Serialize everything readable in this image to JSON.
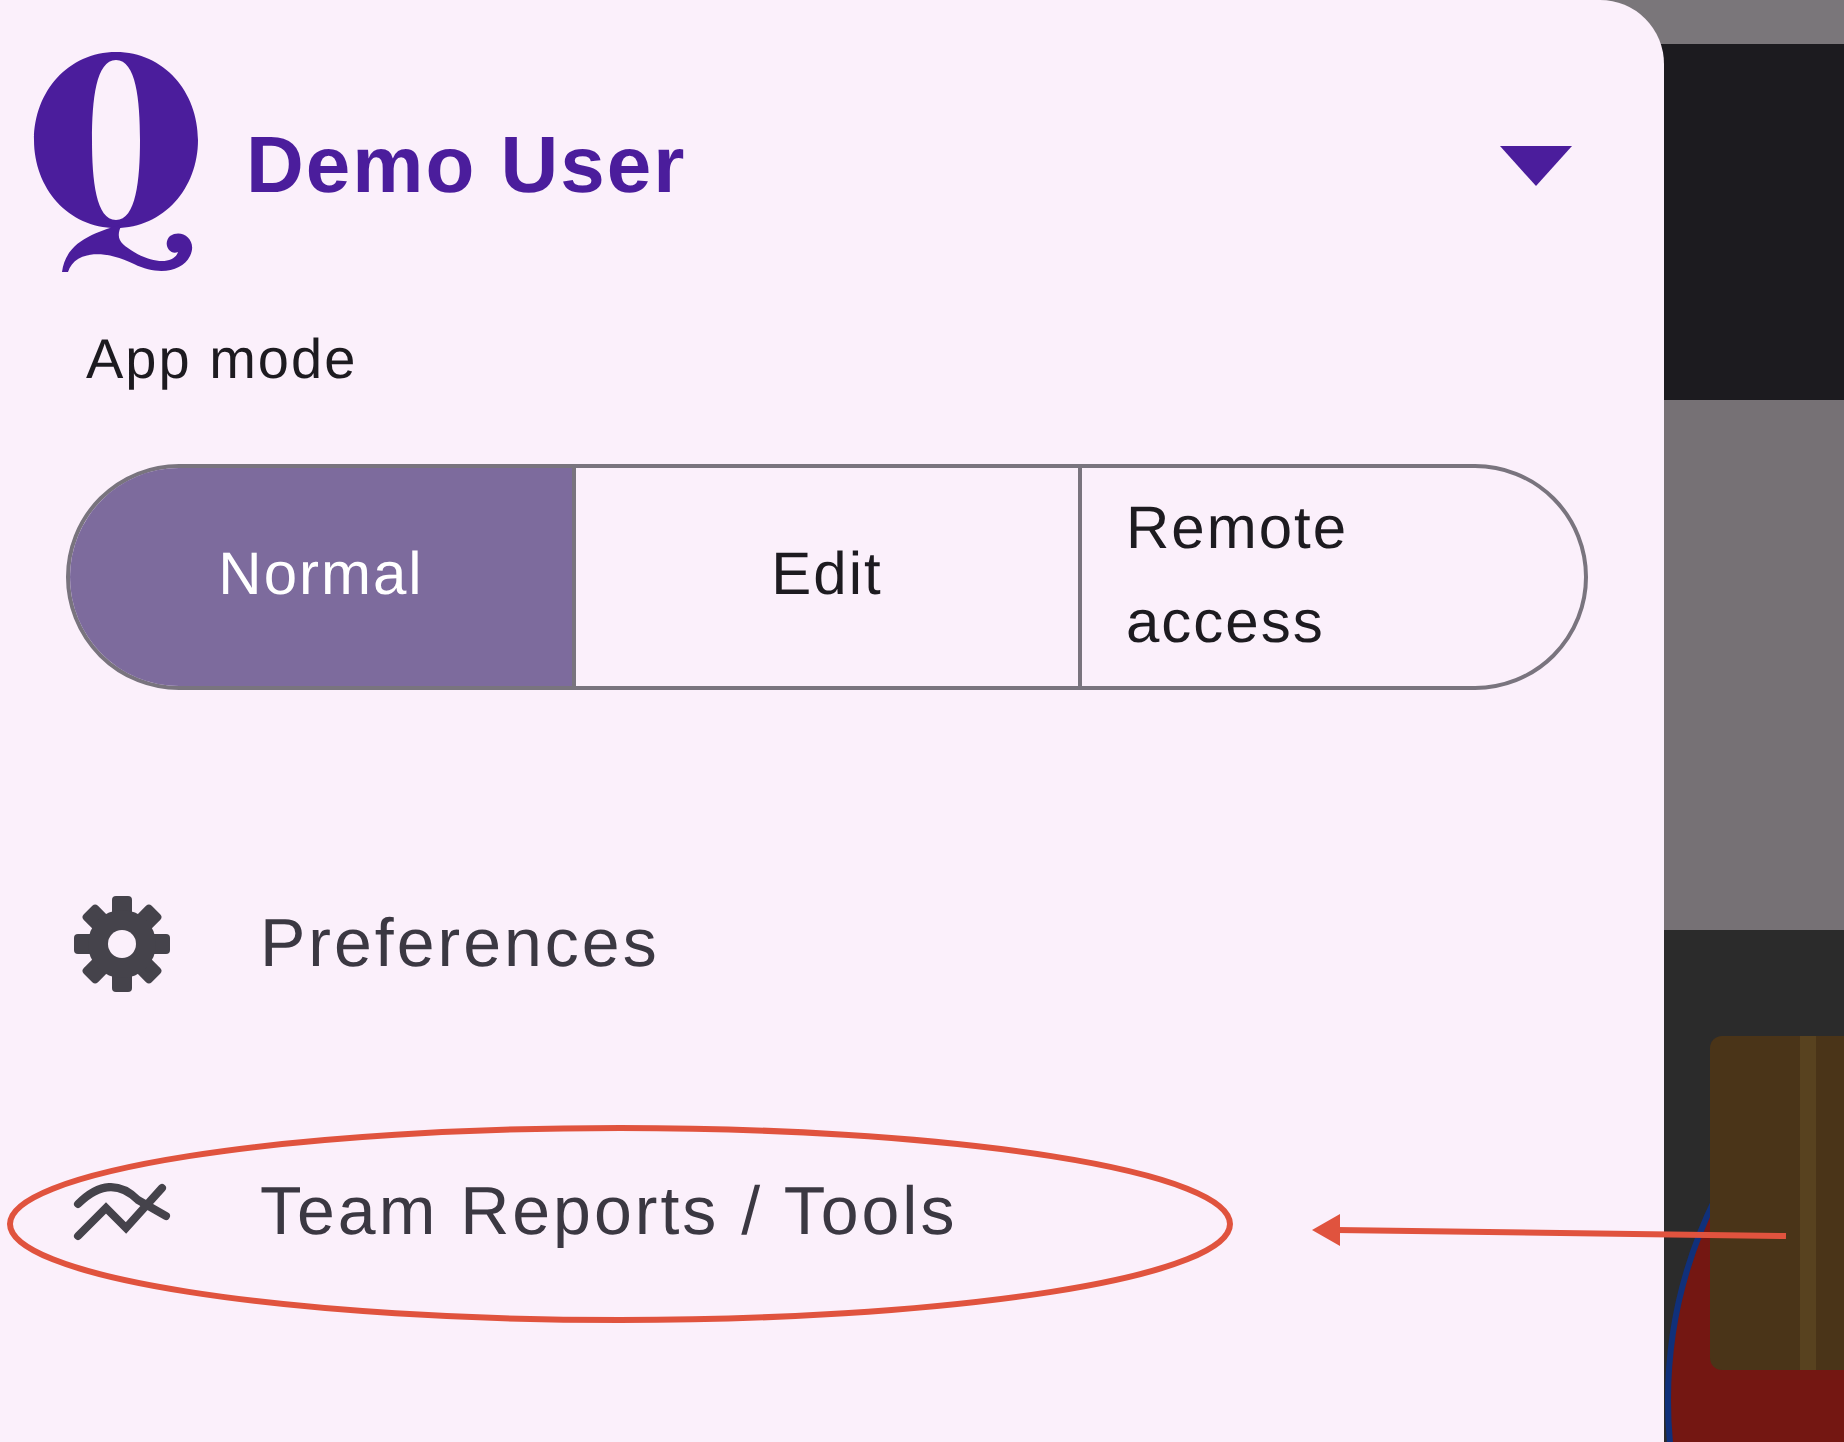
{
  "header": {
    "user_name": "Demo User"
  },
  "app_mode": {
    "label": "App mode",
    "options": [
      {
        "label": "Normal",
        "selected": true
      },
      {
        "label": "Edit",
        "selected": false
      },
      {
        "label": "Remote access",
        "selected": false
      }
    ]
  },
  "menu": [
    {
      "label": "Preferences",
      "kind": "settings"
    },
    {
      "label": "Team Reports / Tools",
      "kind": "reports"
    }
  ]
}
